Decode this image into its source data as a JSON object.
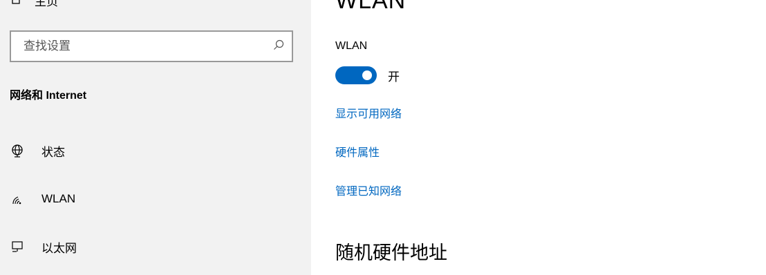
{
  "sidebar": {
    "home_label": "主页",
    "search_placeholder": "查找设置",
    "section_title": "网络和 Internet",
    "items": [
      {
        "label": "状态",
        "icon": "globe-icon"
      },
      {
        "label": "WLAN",
        "icon": "wifi-icon"
      },
      {
        "label": "以太网",
        "icon": "ethernet-icon"
      }
    ]
  },
  "main": {
    "title": "WLAN",
    "wlan_label": "WLAN",
    "toggle_state": "开",
    "toggle_on": true,
    "links": [
      "显示可用网络",
      "硬件属性",
      "管理已知网络"
    ],
    "subheading": "随机硬件地址"
  },
  "colors": {
    "accent": "#0067c0",
    "sidebar_bg": "#f2f2f2"
  }
}
